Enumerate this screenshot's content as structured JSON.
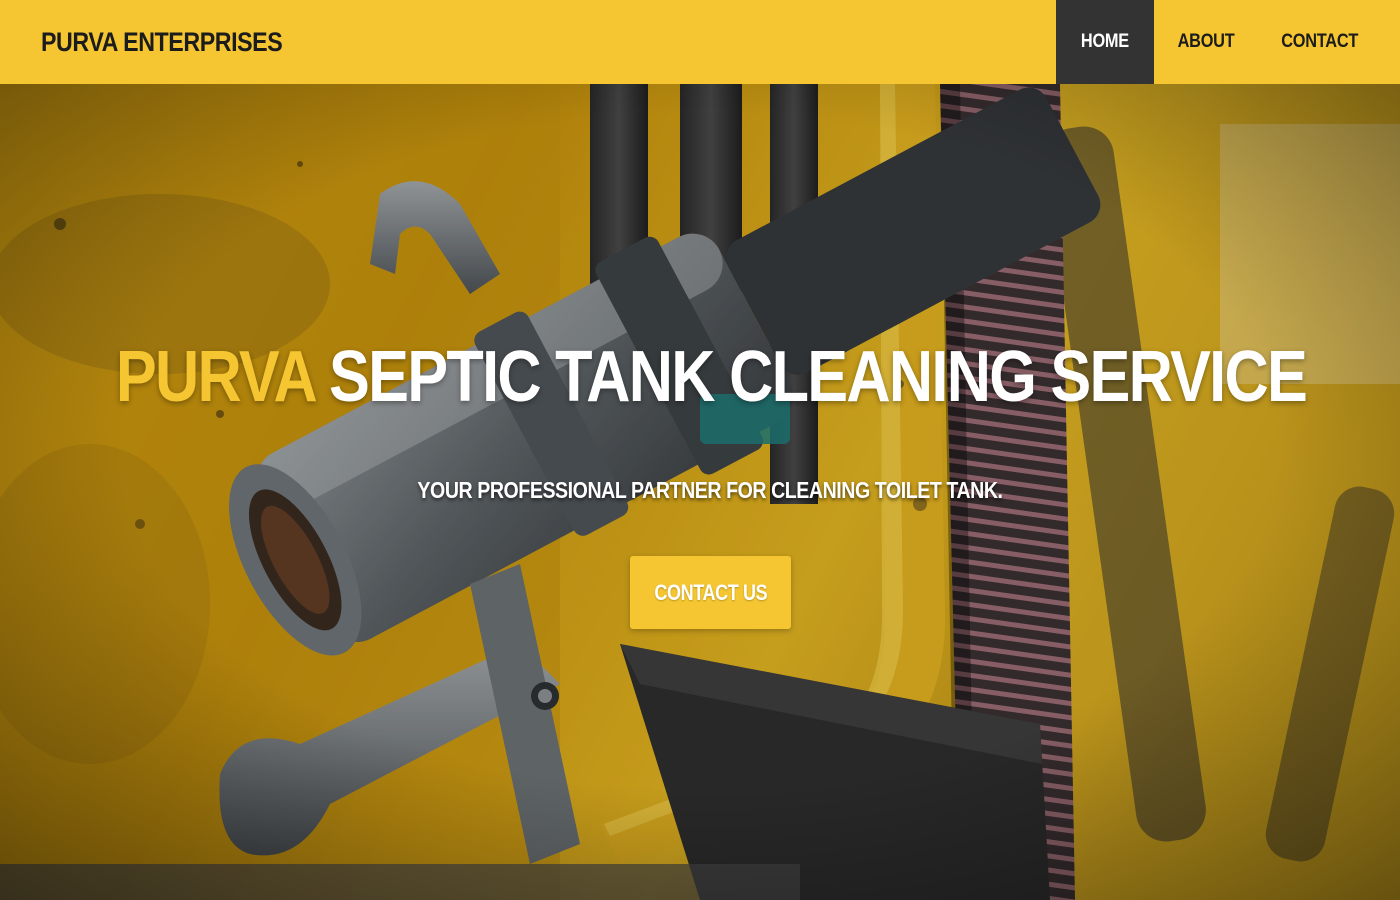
{
  "brand": {
    "name": "PURVA ENTERPRISES"
  },
  "nav": {
    "items": [
      {
        "label": "HOME",
        "active": true
      },
      {
        "label": "ABOUT",
        "active": false
      },
      {
        "label": "CONTACT",
        "active": false
      }
    ]
  },
  "hero": {
    "title_accent": "PURVA",
    "title_rest": " SEPTIC TANK CLEANING SERVICE",
    "subtitle": "YOUR PROFESSIONAL PARTNER FOR CLEANING TOILET TANK.",
    "cta_label": "CONTACT US",
    "background_image": "septic tank truck hose coupling photo"
  },
  "colors": {
    "accent": "#f5c631",
    "nav_active_bg": "#333333",
    "text_dark": "#1c1c1c",
    "text_light": "#ffffff"
  }
}
